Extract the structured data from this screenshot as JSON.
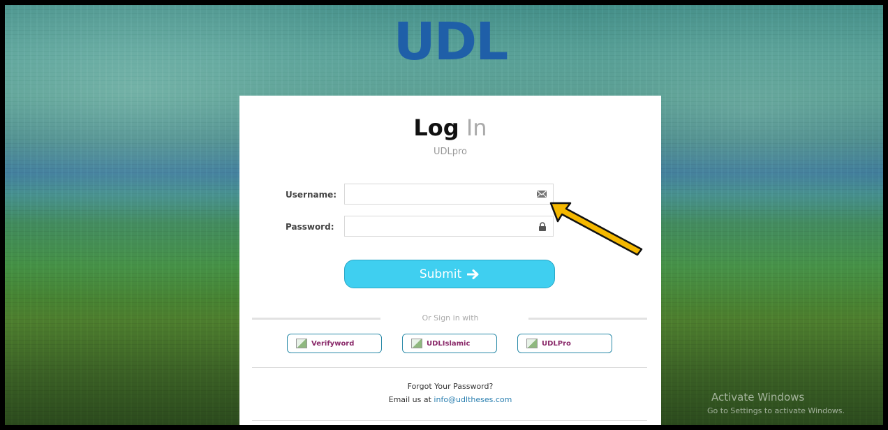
{
  "logo": {
    "text": "UDL"
  },
  "login": {
    "title_bold": "Log",
    "title_light": "In",
    "subtitle": "UDLpro",
    "username_label": "Username:",
    "username_value": "",
    "password_label": "Password:",
    "password_value": "",
    "submit_label": "Submit",
    "submit_icon": "arrow-right-icon"
  },
  "signin_with": {
    "label": "Or Sign in with",
    "providers": [
      {
        "name": "Verifyword"
      },
      {
        "name": "UDLIslamic"
      },
      {
        "name": "UDLPro"
      }
    ]
  },
  "footer": {
    "forgot": "Forgot Your Password?",
    "email_prefix": "Email us at",
    "email": "info@udltheses.com"
  },
  "watermark": {
    "line1": "Activate Windows",
    "line2": "Go to Settings to activate Windows."
  },
  "colors": {
    "logo": "#1f5fa8",
    "submit": "#3fcff0",
    "provider_text": "#8a2a6a",
    "link": "#2a7fb0",
    "annotation_arrow": "#f5b800"
  }
}
